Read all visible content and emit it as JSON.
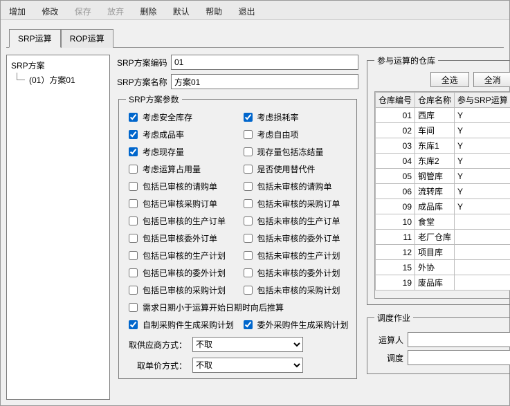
{
  "toolbar": {
    "add": "增加",
    "edit": "修改",
    "save": "保存",
    "abandon": "放弃",
    "delete": "删除",
    "default": "默认",
    "help": "帮助",
    "exit": "退出"
  },
  "tabs": {
    "srp": "SRP运算",
    "rop": "ROP运算"
  },
  "tree": {
    "root": "SRP方案",
    "child": "(01）方案01"
  },
  "form": {
    "code_label": "SRP方案编码",
    "code_value": "01",
    "name_label": "SRP方案名称",
    "name_value": "方案01"
  },
  "params_legend": "SRP方案参数",
  "checks": [
    {
      "label": "考虑安全库存",
      "checked": true
    },
    {
      "label": "考虑损耗率",
      "checked": true
    },
    {
      "label": "考虑成品率",
      "checked": true
    },
    {
      "label": "考虑自由项",
      "checked": false
    },
    {
      "label": "考虑现存量",
      "checked": true
    },
    {
      "label": "现存量包括冻结量",
      "checked": false
    },
    {
      "label": "考虑运算占用量",
      "checked": false
    },
    {
      "label": "是否使用替代件",
      "checked": false
    },
    {
      "label": "包括已审核的请购单",
      "checked": false
    },
    {
      "label": "包括未审核的请购单",
      "checked": false
    },
    {
      "label": "包括已审核采购订单",
      "checked": false
    },
    {
      "label": "包括未审核的采购订单",
      "checked": false
    },
    {
      "label": "包括已审核的生产订单",
      "checked": false
    },
    {
      "label": "包括未审核的生产订单",
      "checked": false
    },
    {
      "label": "包括已审核委外订单",
      "checked": false
    },
    {
      "label": "包括未审核的委外订单",
      "checked": false
    },
    {
      "label": "包括已审核的生产计划",
      "checked": false
    },
    {
      "label": "包括未审核的生产计划",
      "checked": false
    },
    {
      "label": "包括已审核的委外计划",
      "checked": false
    },
    {
      "label": "包括未审核的委外计划",
      "checked": false
    },
    {
      "label": "包括已审核的采购计划",
      "checked": false
    },
    {
      "label": "包括未审核的采购计划",
      "checked": false
    },
    {
      "label": "需求日期小于运算开始日期时向后推算",
      "checked": false,
      "full": true
    },
    {
      "label": "自制采购件生成采购计划",
      "checked": true
    },
    {
      "label": "委外采购件生成采购计划",
      "checked": true
    }
  ],
  "combos": {
    "supplier_label": "取供应商方式：",
    "supplier_value": "不取",
    "price_label": "取单价方式：",
    "price_value": "不取"
  },
  "warehouse": {
    "legend": "参与运算的仓库",
    "select_all": "全选",
    "select_none": "全消",
    "headers": {
      "code": "仓库编号",
      "name": "仓库名称",
      "flag": "参与SRP运算"
    },
    "rows": [
      {
        "code": "01",
        "name": "西库",
        "flag": "Y"
      },
      {
        "code": "02",
        "name": "车间",
        "flag": "Y"
      },
      {
        "code": "03",
        "name": "东库1",
        "flag": "Y"
      },
      {
        "code": "04",
        "name": "东库2",
        "flag": "Y"
      },
      {
        "code": "05",
        "name": "钢管库",
        "flag": "Y"
      },
      {
        "code": "06",
        "name": "流转库",
        "flag": "Y"
      },
      {
        "code": "09",
        "name": "成品库",
        "flag": "Y"
      },
      {
        "code": "10",
        "name": "食堂",
        "flag": ""
      },
      {
        "code": "11",
        "name": "老厂仓库",
        "flag": ""
      },
      {
        "code": "12",
        "name": "项目库",
        "flag": ""
      },
      {
        "code": "15",
        "name": "外协",
        "flag": ""
      },
      {
        "code": "19",
        "name": "废品库",
        "flag": ""
      }
    ]
  },
  "schedule": {
    "legend": "调度作业",
    "operator_label": "运算人",
    "operator_value": "",
    "dispatch_label": "调度",
    "dispatch_value": ""
  }
}
